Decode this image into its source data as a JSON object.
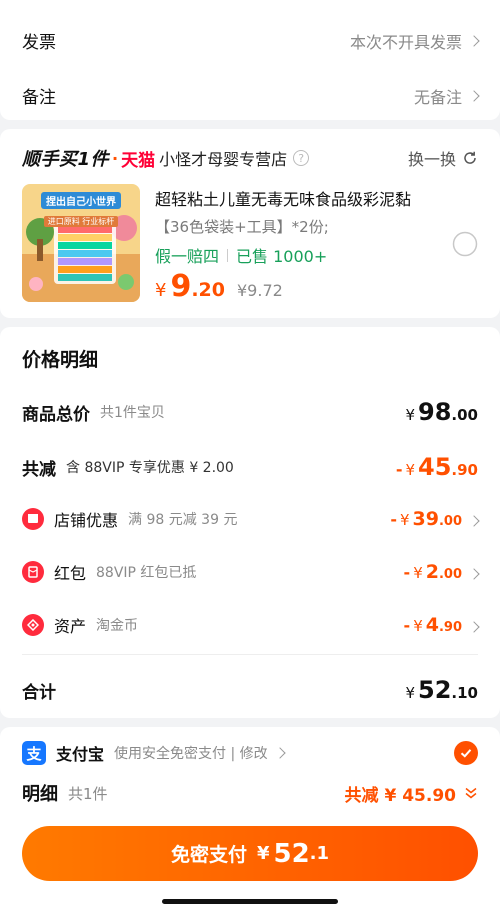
{
  "top": {
    "invoice": {
      "label": "发票",
      "value": "本次不开具发票"
    },
    "remark": {
      "label": "备注",
      "value": "无备注"
    }
  },
  "recommend": {
    "brand": "顺手买1件",
    "sep": "·",
    "store_brand": "天猫",
    "shop": "小怪才母婴专营店",
    "help": "?",
    "swap": "换一换",
    "thumb_text": {
      "line1": "捏出自己小世界",
      "line2": "进口原料  行业标杆"
    },
    "product": {
      "title": "超轻粘土儿童无毒无味食品级彩泥黏",
      "spec": "【36色袋装+工具】*2份;",
      "tag1": "假一赔四",
      "tag2": "已售 1000+",
      "currency": "¥",
      "price_int": "9",
      "price_dec": ".20",
      "orig": "¥9.72"
    }
  },
  "price_detail": {
    "title": "价格明细",
    "goods_total": {
      "label": "商品总价",
      "sub": "共1件宝贝",
      "cur": "¥",
      "int": "98",
      "dec": ".00"
    },
    "reduce": {
      "label": "共减",
      "sub": "含 88VIP 专享优惠 ¥ 2.00",
      "minus": "-",
      "cur": "¥",
      "int": "45",
      "dec": ".90"
    },
    "shop_discount": {
      "label": "店铺优惠",
      "sub": "满 98 元减 39 元",
      "minus": "-",
      "cur": "¥",
      "int": "39",
      "dec": ".00"
    },
    "red_packet": {
      "label": "红包",
      "sub": "88VIP 红包已抵",
      "minus": "-",
      "cur": "¥",
      "int": "2",
      "dec": ".00"
    },
    "assets": {
      "label": "资产",
      "sub": "淘金币",
      "minus": "-",
      "cur": "¥",
      "int": "4",
      "dec": ".90"
    },
    "total": {
      "label": "合计",
      "cur": "¥",
      "int": "52",
      "dec": ".10"
    }
  },
  "bottom": {
    "alipay_icon": "支",
    "pay_name": "支付宝",
    "pay_desc": "使用安全免密支付 | 修改",
    "detail_label": "明细",
    "detail_count": "共1件",
    "detail_reduce": "共减 ¥ 45.90",
    "button": {
      "text": "免密支付",
      "cur": "¥",
      "int": "52",
      "dec": ".1"
    }
  },
  "colors": {
    "accent": "#ff5000",
    "green": "#18a05a",
    "alipay": "#1677ff",
    "red_icon": "#ff2b3d"
  },
  "icons": [
    "question-icon",
    "refresh-icon",
    "radio-icon",
    "shop-discount-icon",
    "red-packet-icon",
    "assets-icon",
    "alipay-icon",
    "check-icon",
    "double-chevron-down-icon"
  ]
}
